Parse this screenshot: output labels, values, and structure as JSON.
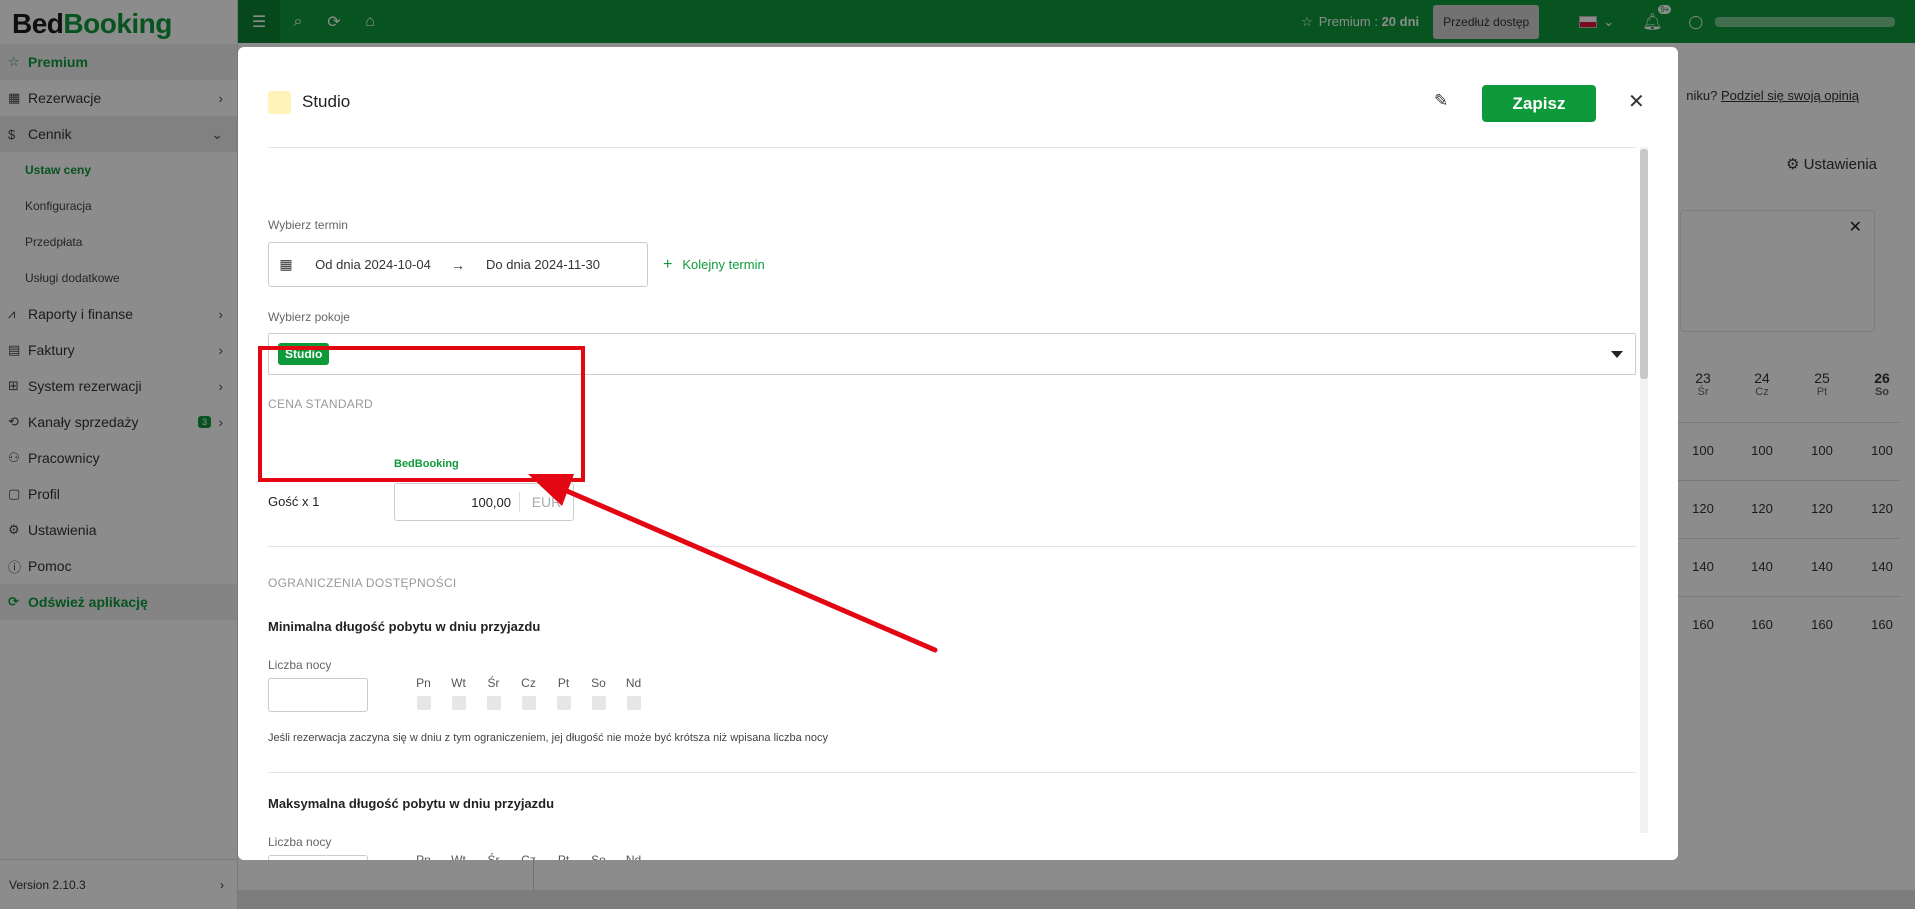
{
  "app": {
    "logo_part1": "Bed",
    "logo_part2": "Booking"
  },
  "sidebar": {
    "premium": "Premium",
    "items": [
      {
        "label": "Rezerwacje",
        "icon": "calendar-icon"
      },
      {
        "label": "Cennik",
        "icon": "dollar-icon"
      },
      {
        "label": "Raporty i finanse",
        "icon": "chart-icon"
      },
      {
        "label": "Faktury",
        "icon": "invoice-icon"
      },
      {
        "label": "System rezerwacji",
        "icon": "grid-icon"
      },
      {
        "label": "Kanały sprzedaży",
        "icon": "channels-icon",
        "badge": "3"
      },
      {
        "label": "Pracownicy",
        "icon": "users-icon"
      },
      {
        "label": "Profil",
        "icon": "profile-icon"
      },
      {
        "label": "Ustawienia",
        "icon": "gear-icon"
      },
      {
        "label": "Pomoc",
        "icon": "help-icon"
      }
    ],
    "sub_items": [
      "Ustaw ceny",
      "Konfiguracja",
      "Przedpłata",
      "Usługi dodatkowe"
    ],
    "refresh": "Odśwież aplikację",
    "version": "Version 2.10.3"
  },
  "topbar": {
    "premium_label": "Premium :",
    "premium_days": "20 dni",
    "extend_button": "Przedłuż dostęp",
    "notifications": "9+"
  },
  "background": {
    "link_prefix": "niku?",
    "link_text": "Podziel się swoją opinią",
    "settings": "Ustawienia",
    "calendar_days": [
      {
        "num": "23",
        "name": "Śr"
      },
      {
        "num": "24",
        "name": "Cz"
      },
      {
        "num": "25",
        "name": "Pt"
      },
      {
        "num": "26",
        "name": "So"
      }
    ],
    "calendar_rows": [
      [
        "100",
        "100",
        "100",
        "100"
      ],
      [
        "120",
        "120",
        "120",
        "120"
      ],
      [
        "140",
        "140",
        "140",
        "140"
      ],
      [
        "160",
        "160",
        "160",
        "160"
      ]
    ]
  },
  "modal": {
    "title": "Studio",
    "swatch_color": "#fff3b8",
    "save_button": "Zapisz",
    "choose_term_label": "Wybierz termin",
    "date_from": "Od dnia 2024-10-04",
    "date_to": "Do dnia 2024-11-30",
    "next_term": "Kolejny termin",
    "choose_rooms_label": "Wybierz pokoje",
    "selected_room": "Studio",
    "price_section": "CENA STANDARD",
    "channel": "BedBooking",
    "guest_label": "Gość x 1",
    "price_value": "100,00",
    "currency": "EUR",
    "restrictions_section": "OGRANICZENIA DOSTĘPNOŚCI",
    "min_stay_title": "Minimalna długość pobytu w dniu przyjazdu",
    "nights_label": "Liczba nocy",
    "weekdays": [
      "Pn",
      "Wt",
      "Śr",
      "Cz",
      "Pt",
      "So",
      "Nd"
    ],
    "min_stay_hint": "Jeśli rezerwacja zaczyna się w dniu z tym ograniczeniem, jej długość nie może być krótsza niż wpisana liczba nocy",
    "max_stay_title": "Maksymalna długość pobytu w dniu przyjazdu",
    "nights_label_2": "Liczba nocy"
  },
  "colors": {
    "brand": "#0e9a3b",
    "annotation": "#e30613"
  }
}
